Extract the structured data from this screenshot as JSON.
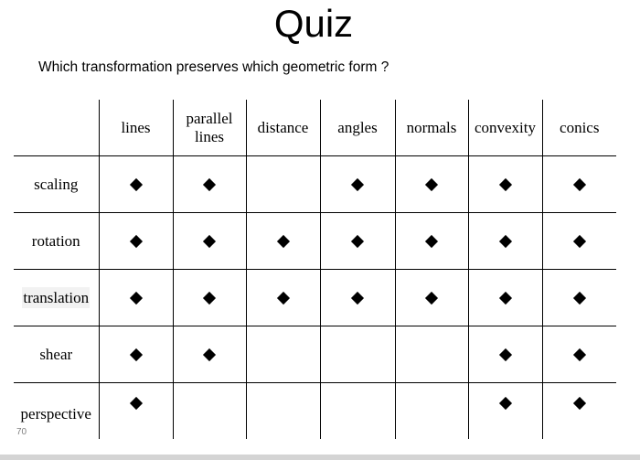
{
  "slide": {
    "title": "Quiz",
    "question": "Which transformation preserves which geometric form ?",
    "page_number": "70"
  },
  "table": {
    "columns": [
      "lines",
      "parallel\nlines",
      "distance",
      "angles",
      "normals",
      "convexity",
      "conics"
    ],
    "rows": [
      {
        "label": "scaling",
        "marks": [
          true,
          true,
          false,
          true,
          true,
          true,
          true
        ]
      },
      {
        "label": "rotation",
        "marks": [
          true,
          true,
          true,
          true,
          true,
          true,
          true
        ]
      },
      {
        "label": "translation",
        "marks": [
          true,
          true,
          true,
          true,
          true,
          true,
          true
        ]
      },
      {
        "label": "shear",
        "marks": [
          true,
          true,
          false,
          false,
          false,
          true,
          true
        ]
      },
      {
        "label": "perspective",
        "marks": [
          true,
          false,
          false,
          false,
          false,
          true,
          true
        ]
      }
    ],
    "mark_icon": "black-diamond-icon"
  }
}
